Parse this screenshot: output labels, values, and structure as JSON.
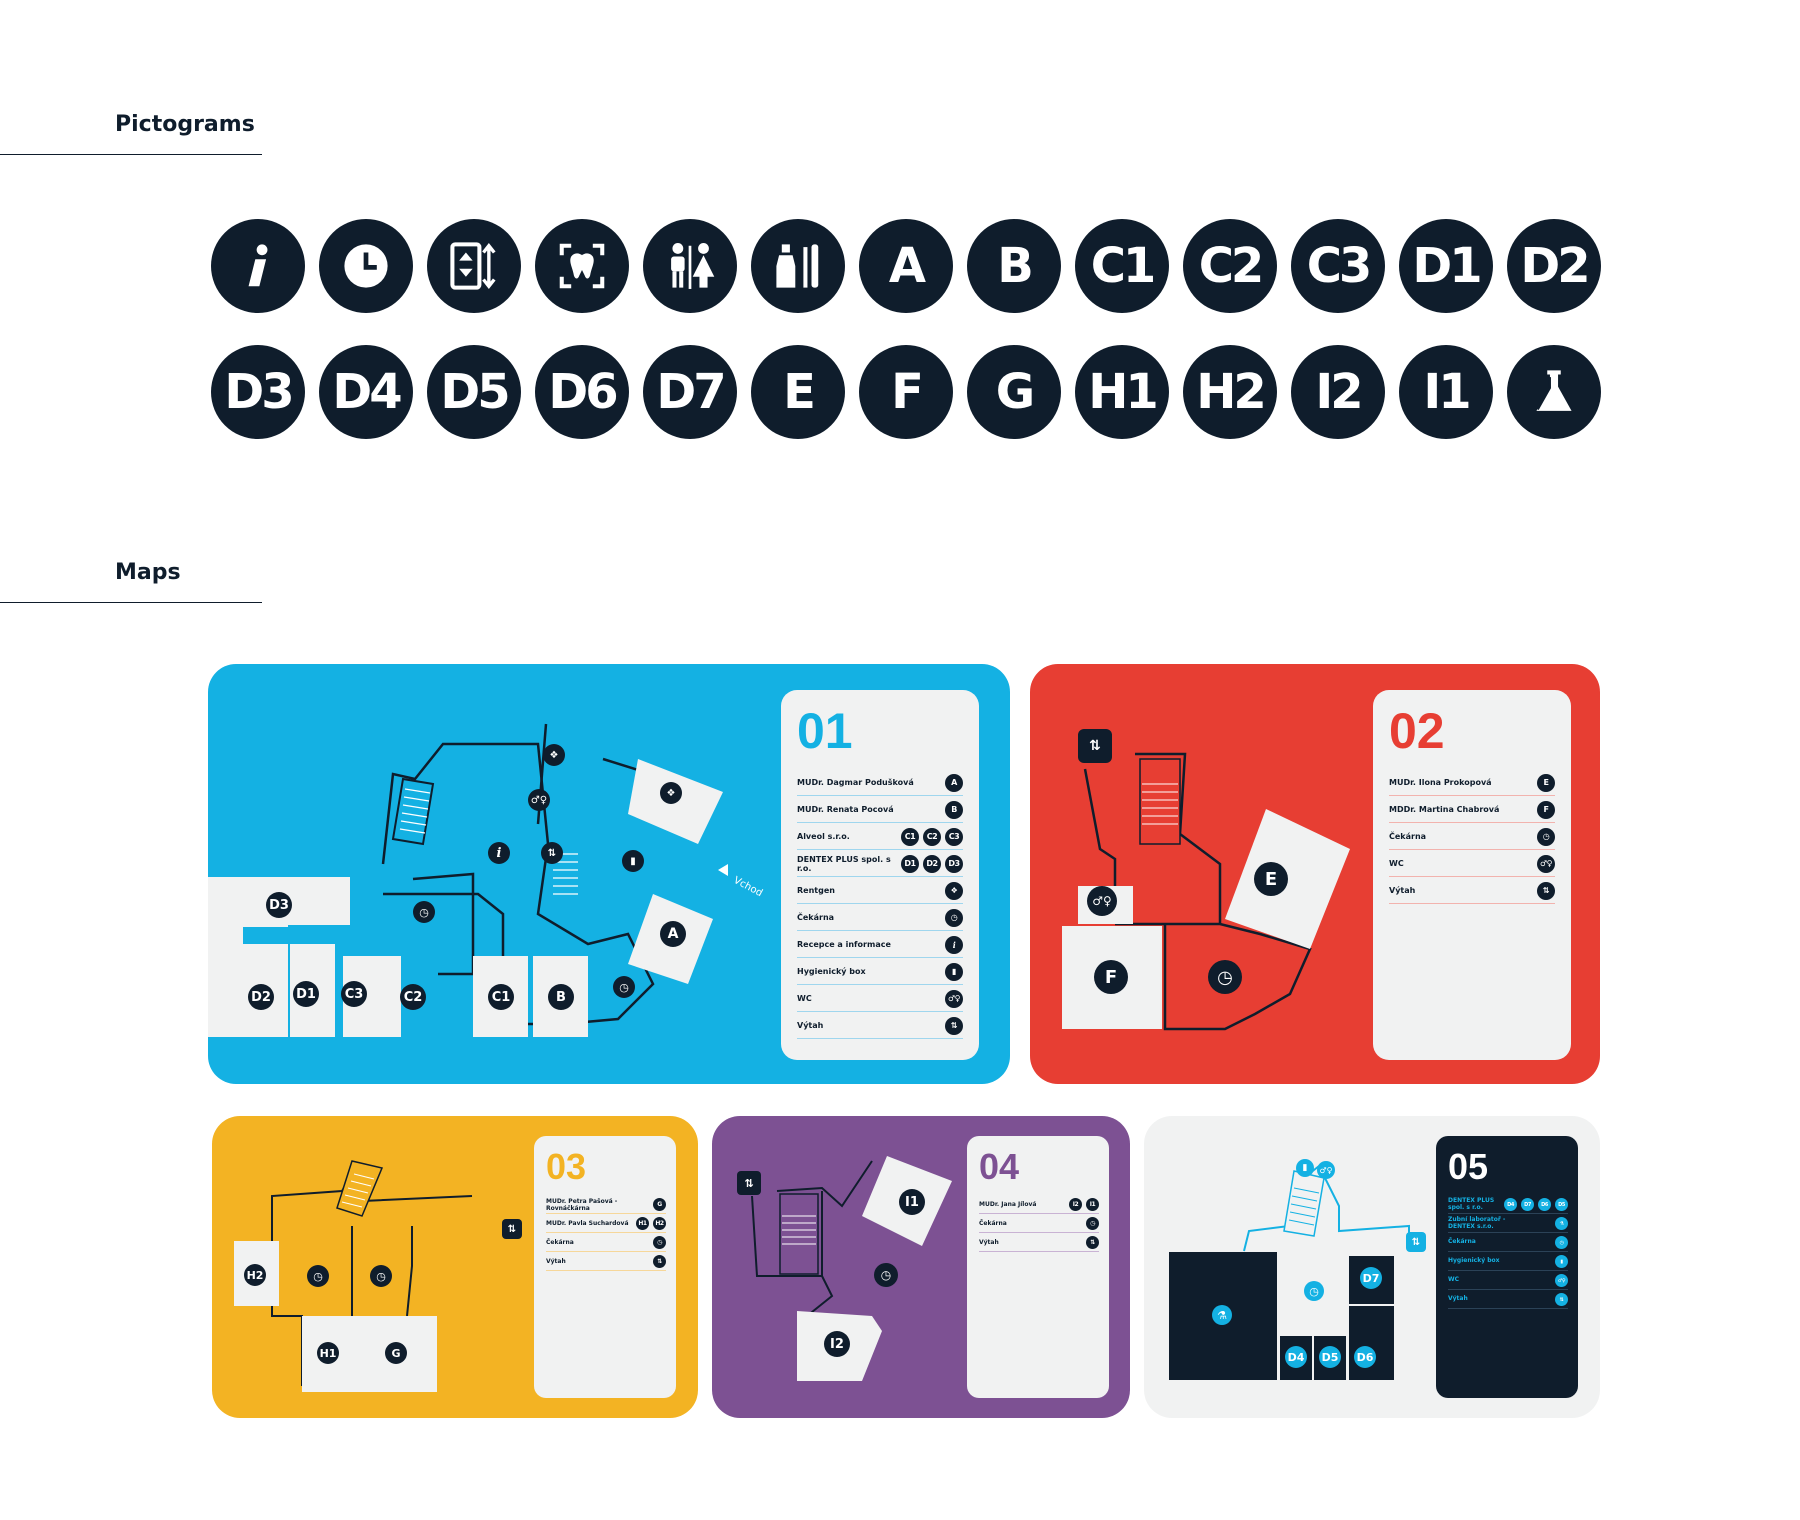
{
  "sections": {
    "pictograms": "Pictograms",
    "maps": "Maps"
  },
  "pictograms": {
    "row1": [
      {
        "icon": "info-icon"
      },
      {
        "icon": "clock-icon"
      },
      {
        "icon": "elevator-icon"
      },
      {
        "icon": "tooth-icon"
      },
      {
        "icon": "wc-icon"
      },
      {
        "icon": "hygiene-box-icon"
      },
      {
        "text": "A"
      },
      {
        "text": "B"
      },
      {
        "text": "C1"
      },
      {
        "text": "C2"
      },
      {
        "text": "C3"
      },
      {
        "text": "D1"
      },
      {
        "text": "D2"
      }
    ],
    "row2": [
      {
        "text": "D3"
      },
      {
        "text": "D4"
      },
      {
        "text": "D5"
      },
      {
        "text": "D6"
      },
      {
        "text": "D7"
      },
      {
        "text": "E"
      },
      {
        "text": "F"
      },
      {
        "text": "G"
      },
      {
        "text": "H1"
      },
      {
        "text": "H2"
      },
      {
        "text": "I2"
      },
      {
        "text": "I1"
      },
      {
        "icon": "flask-icon"
      }
    ]
  },
  "colors": {
    "navy": "#0f1d2c",
    "blue": "#14b1e3",
    "red": "#e73e33",
    "yellow": "#f3b323",
    "purple": "#7d5193",
    "light": "#f1f2f2"
  },
  "maps": {
    "floor1": {
      "number": "01",
      "entrance": "Vchod",
      "rooms": [
        "D3",
        "D2",
        "D1",
        "C3",
        "C2",
        "C1",
        "B",
        "A"
      ],
      "legend": [
        {
          "label": "MUDr. Dagmar Podušková",
          "badges": [
            "A"
          ]
        },
        {
          "label": "MUDr. Renata Pocová",
          "badges": [
            "B"
          ]
        },
        {
          "label": "Alveol s.r.o.",
          "badges": [
            "C1",
            "C2",
            "C3"
          ]
        },
        {
          "label": "DENTEX PLUS spol. s r.o.",
          "badges": [
            "D1",
            "D2",
            "D3"
          ]
        },
        {
          "label": "Rentgen",
          "badges": [
            "tooth"
          ]
        },
        {
          "label": "Čekárna",
          "badges": [
            "clock"
          ]
        },
        {
          "label": "Recepce a informace",
          "badges": [
            "info"
          ]
        },
        {
          "label": "Hygienický box",
          "badges": [
            "hyg"
          ]
        },
        {
          "label": "WC",
          "badges": [
            "wc"
          ]
        },
        {
          "label": "Výtah",
          "badges": [
            "lift"
          ]
        }
      ]
    },
    "floor2": {
      "number": "02",
      "rooms": [
        "E",
        "F"
      ],
      "legend": [
        {
          "label": "MUDr. Ilona Prokopová",
          "badges": [
            "E"
          ]
        },
        {
          "label": "MDDr. Martina Chabrová",
          "badges": [
            "F"
          ]
        },
        {
          "label": "Čekárna",
          "badges": [
            "clock"
          ]
        },
        {
          "label": "WC",
          "badges": [
            "wc"
          ]
        },
        {
          "label": "Výtah",
          "badges": [
            "lift"
          ]
        }
      ]
    },
    "floor3": {
      "number": "03",
      "rooms": [
        "H2",
        "H1",
        "G"
      ],
      "legend": [
        {
          "label": "MUDr. Petra Pašová - Rovnáčkárna",
          "badges": [
            "G"
          ]
        },
        {
          "label": "MUDr. Pavla Suchardová",
          "badges": [
            "H1",
            "H2"
          ]
        },
        {
          "label": "Čekárna",
          "badges": [
            "clock"
          ]
        },
        {
          "label": "Výtah",
          "badges": [
            "lift"
          ]
        }
      ]
    },
    "floor4": {
      "number": "04",
      "rooms": [
        "I1",
        "I2"
      ],
      "legend": [
        {
          "label": "MUDr. Jana Jílová",
          "badges": [
            "I2",
            "I1"
          ]
        },
        {
          "label": "Čekárna",
          "badges": [
            "clock"
          ]
        },
        {
          "label": "Výtah",
          "badges": [
            "lift"
          ]
        }
      ]
    },
    "floor5": {
      "number": "05",
      "rooms": [
        "D7",
        "D4",
        "D5",
        "D6"
      ],
      "legend": [
        {
          "label": "DENTEX PLUS spol. s r.o.",
          "badges": [
            "D4",
            "D7",
            "D6",
            "D5"
          ]
        },
        {
          "label": "Zubní laboratoř - DENTEX s.r.o.",
          "badges": [
            "flask"
          ]
        },
        {
          "label": "Čekárna",
          "badges": [
            "clock"
          ]
        },
        {
          "label": "Hygienický box",
          "badges": [
            "hyg"
          ]
        },
        {
          "label": "WC",
          "badges": [
            "wc"
          ]
        },
        {
          "label": "Výtah",
          "badges": [
            "lift"
          ]
        }
      ]
    }
  }
}
